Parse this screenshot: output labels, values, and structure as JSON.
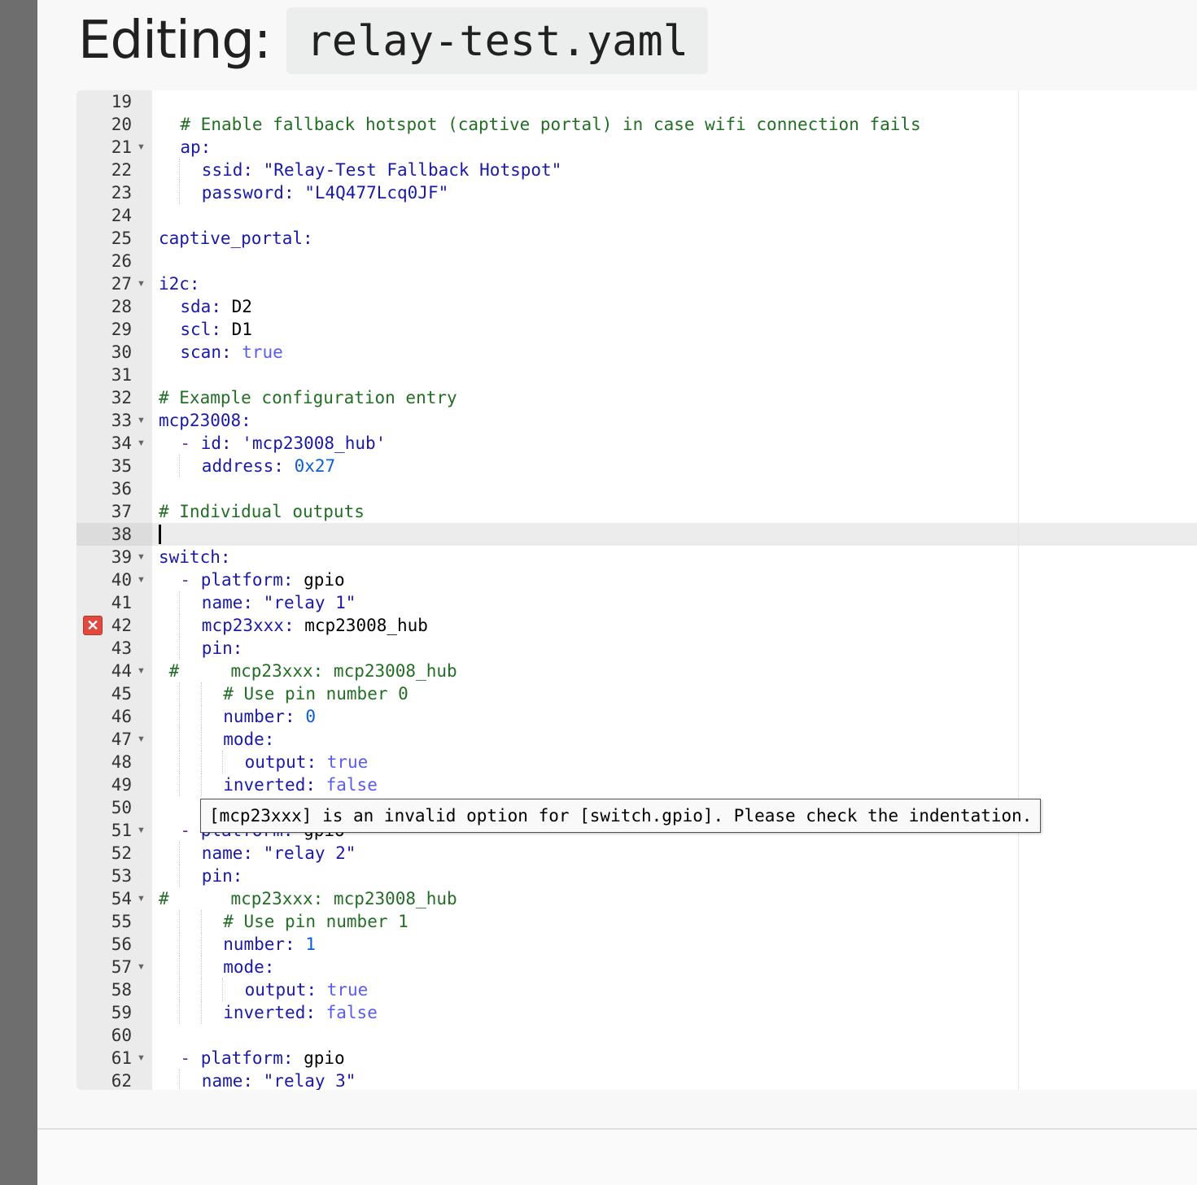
{
  "title": {
    "label": "Editing:",
    "filename": "relay-test.yaml"
  },
  "error_tooltip": "[mcp23xxx] is an invalid option for [switch.gpio]. Please check the indentation.",
  "error_line": 42,
  "active_line": 38,
  "lines": [
    {
      "n": 19,
      "fold": false,
      "indent": 0,
      "segs": []
    },
    {
      "n": 20,
      "fold": false,
      "indent": 1,
      "segs": [
        {
          "t": "# Enable fallback hotspot (captive portal) in case wifi connection fails",
          "c": "c"
        }
      ]
    },
    {
      "n": 21,
      "fold": true,
      "indent": 1,
      "segs": [
        {
          "t": "ap:",
          "c": "k"
        }
      ]
    },
    {
      "n": 22,
      "fold": false,
      "indent": 2,
      "segs": [
        {
          "t": "ssid: ",
          "c": "k"
        },
        {
          "t": "\"Relay-Test Fallback Hotspot\"",
          "c": "s"
        }
      ]
    },
    {
      "n": 23,
      "fold": false,
      "indent": 2,
      "segs": [
        {
          "t": "password: ",
          "c": "k"
        },
        {
          "t": "\"L4Q477Lcq0JF\"",
          "c": "s"
        }
      ]
    },
    {
      "n": 24,
      "fold": false,
      "indent": 0,
      "segs": []
    },
    {
      "n": 25,
      "fold": false,
      "indent": 0,
      "segs": [
        {
          "t": "captive_portal:",
          "c": "k"
        }
      ]
    },
    {
      "n": 26,
      "fold": false,
      "indent": 0,
      "segs": []
    },
    {
      "n": 27,
      "fold": true,
      "indent": 0,
      "segs": [
        {
          "t": "i2c:",
          "c": "k"
        }
      ]
    },
    {
      "n": 28,
      "fold": false,
      "indent": 1,
      "segs": [
        {
          "t": "sda: ",
          "c": "k"
        },
        {
          "t": "D2",
          "c": "p"
        }
      ]
    },
    {
      "n": 29,
      "fold": false,
      "indent": 1,
      "segs": [
        {
          "t": "scl: ",
          "c": "k"
        },
        {
          "t": "D1",
          "c": "p"
        }
      ]
    },
    {
      "n": 30,
      "fold": false,
      "indent": 1,
      "segs": [
        {
          "t": "scan: ",
          "c": "k"
        },
        {
          "t": "true",
          "c": "b"
        }
      ]
    },
    {
      "n": 31,
      "fold": false,
      "indent": 0,
      "segs": []
    },
    {
      "n": 32,
      "fold": false,
      "indent": 0,
      "segs": [
        {
          "t": "# Example configuration entry",
          "c": "c"
        }
      ]
    },
    {
      "n": 33,
      "fold": true,
      "indent": 0,
      "segs": [
        {
          "t": "mcp23008:",
          "c": "k"
        }
      ]
    },
    {
      "n": 34,
      "fold": true,
      "indent": 1,
      "segs": [
        {
          "t": "- ",
          "c": "dash"
        },
        {
          "t": "id: ",
          "c": "k"
        },
        {
          "t": "'mcp23008_hub'",
          "c": "s"
        }
      ]
    },
    {
      "n": 35,
      "fold": false,
      "indent": 2,
      "segs": [
        {
          "t": "address: ",
          "c": "k"
        },
        {
          "t": "0x27",
          "c": "n"
        }
      ]
    },
    {
      "n": 36,
      "fold": false,
      "indent": 0,
      "segs": []
    },
    {
      "n": 37,
      "fold": false,
      "indent": 0,
      "segs": [
        {
          "t": "# Individual outputs",
          "c": "c"
        }
      ]
    },
    {
      "n": 38,
      "fold": false,
      "indent": 0,
      "segs": []
    },
    {
      "n": 39,
      "fold": true,
      "indent": 0,
      "segs": [
        {
          "t": "switch:",
          "c": "k"
        }
      ]
    },
    {
      "n": 40,
      "fold": true,
      "indent": 1,
      "segs": [
        {
          "t": "- ",
          "c": "dash"
        },
        {
          "t": "platform: ",
          "c": "k"
        },
        {
          "t": "gpio",
          "c": "p"
        }
      ]
    },
    {
      "n": 41,
      "fold": false,
      "indent": 2,
      "segs": [
        {
          "t": "name: ",
          "c": "k"
        },
        {
          "t": "\"relay 1\"",
          "c": "s"
        }
      ]
    },
    {
      "n": 42,
      "fold": false,
      "indent": 2,
      "segs": [
        {
          "t": "mcp23xxx: ",
          "c": "k"
        },
        {
          "t": "mcp23008_hub",
          "c": "p"
        }
      ]
    },
    {
      "n": 43,
      "fold": false,
      "indent": 2,
      "segs": [
        {
          "t": "pin:",
          "c": "k"
        }
      ]
    },
    {
      "n": 44,
      "fold": true,
      "indent": 0,
      "segs": [
        {
          "t": " #     mcp23xxx: mcp23008_hub",
          "c": "c"
        }
      ]
    },
    {
      "n": 45,
      "fold": false,
      "indent": 3,
      "segs": [
        {
          "t": "# Use pin number 0",
          "c": "c"
        }
      ]
    },
    {
      "n": 46,
      "fold": false,
      "indent": 3,
      "segs": [
        {
          "t": "number: ",
          "c": "k"
        },
        {
          "t": "0",
          "c": "n"
        }
      ]
    },
    {
      "n": 47,
      "fold": true,
      "indent": 3,
      "segs": [
        {
          "t": "mode:",
          "c": "k"
        }
      ]
    },
    {
      "n": 48,
      "fold": false,
      "indent": 4,
      "segs": [
        {
          "t": "output: ",
          "c": "k"
        },
        {
          "t": "true",
          "c": "b"
        }
      ]
    },
    {
      "n": 49,
      "fold": false,
      "indent": 3,
      "segs": [
        {
          "t": "inverted: ",
          "c": "k"
        },
        {
          "t": "false",
          "c": "b"
        }
      ]
    },
    {
      "n": 50,
      "fold": false,
      "indent": 0,
      "segs": []
    },
    {
      "n": 51,
      "fold": true,
      "indent": 1,
      "segs": [
        {
          "t": "- ",
          "c": "dash"
        },
        {
          "t": "platform: ",
          "c": "k"
        },
        {
          "t": "gpio",
          "c": "p"
        }
      ]
    },
    {
      "n": 52,
      "fold": false,
      "indent": 2,
      "segs": [
        {
          "t": "name: ",
          "c": "k"
        },
        {
          "t": "\"relay 2\"",
          "c": "s"
        }
      ]
    },
    {
      "n": 53,
      "fold": false,
      "indent": 2,
      "segs": [
        {
          "t": "pin:",
          "c": "k"
        }
      ]
    },
    {
      "n": 54,
      "fold": true,
      "indent": 0,
      "segs": [
        {
          "t": "#      mcp23xxx: mcp23008_hub",
          "c": "c"
        }
      ]
    },
    {
      "n": 55,
      "fold": false,
      "indent": 3,
      "segs": [
        {
          "t": "# Use pin number 1",
          "c": "c"
        }
      ]
    },
    {
      "n": 56,
      "fold": false,
      "indent": 3,
      "segs": [
        {
          "t": "number: ",
          "c": "k"
        },
        {
          "t": "1",
          "c": "n"
        }
      ]
    },
    {
      "n": 57,
      "fold": true,
      "indent": 3,
      "segs": [
        {
          "t": "mode:",
          "c": "k"
        }
      ]
    },
    {
      "n": 58,
      "fold": false,
      "indent": 4,
      "segs": [
        {
          "t": "output: ",
          "c": "k"
        },
        {
          "t": "true",
          "c": "b"
        }
      ]
    },
    {
      "n": 59,
      "fold": false,
      "indent": 3,
      "segs": [
        {
          "t": "inverted: ",
          "c": "k"
        },
        {
          "t": "false",
          "c": "b"
        }
      ]
    },
    {
      "n": 60,
      "fold": false,
      "indent": 0,
      "segs": []
    },
    {
      "n": 61,
      "fold": true,
      "indent": 1,
      "segs": [
        {
          "t": "- ",
          "c": "dash"
        },
        {
          "t": "platform: ",
          "c": "k"
        },
        {
          "t": "gpio",
          "c": "p"
        }
      ]
    },
    {
      "n": 62,
      "fold": false,
      "indent": 2,
      "segs": [
        {
          "t": "name: ",
          "c": "k"
        },
        {
          "t": "\"relay 3\"",
          "c": "s"
        }
      ]
    }
  ]
}
